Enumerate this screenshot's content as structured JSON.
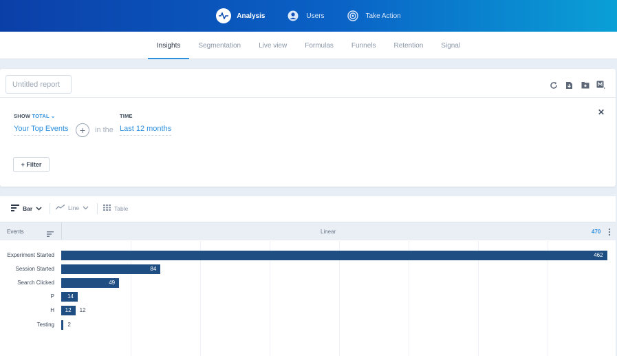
{
  "topnav": {
    "items": [
      {
        "label": "Analysis",
        "icon": "pulse-icon",
        "active": true
      },
      {
        "label": "Users",
        "icon": "user-icon",
        "active": false
      },
      {
        "label": "Take Action",
        "icon": "target-icon",
        "active": false
      }
    ]
  },
  "subnav": {
    "tabs": [
      {
        "label": "Insights",
        "active": true
      },
      {
        "label": "Segmentation",
        "active": false
      },
      {
        "label": "Live view",
        "active": false
      },
      {
        "label": "Formulas",
        "active": false
      },
      {
        "label": "Funnels",
        "active": false
      },
      {
        "label": "Retention",
        "active": false
      },
      {
        "label": "Signal",
        "active": false
      }
    ]
  },
  "report": {
    "title_placeholder": "Untitled report",
    "show_label": "SHOW",
    "show_value": "TOTAL",
    "show_events": "Your Top Events",
    "in_the": "in the",
    "time_label": "TIME",
    "time_value": "Last 12 months",
    "filter_label": "+ Filter"
  },
  "toolbar": {
    "bar_label": "Bar",
    "line_label": "Line",
    "table_label": "Table"
  },
  "table_header": {
    "events_label": "Events",
    "scale_label": "Linear",
    "max_label": "470"
  },
  "colors": {
    "bar": "#1f4e82",
    "accent": "#2d8fe0"
  },
  "chart_data": {
    "type": "bar",
    "orientation": "horizontal",
    "categories": [
      "Experiment Started",
      "Session Started",
      "Search Clicked",
      "P",
      "H",
      "Testing"
    ],
    "values": [
      462,
      84,
      49,
      14,
      12,
      2
    ],
    "xlim": [
      0,
      470
    ],
    "xlabel": "",
    "ylabel": "Events",
    "grid": true
  }
}
